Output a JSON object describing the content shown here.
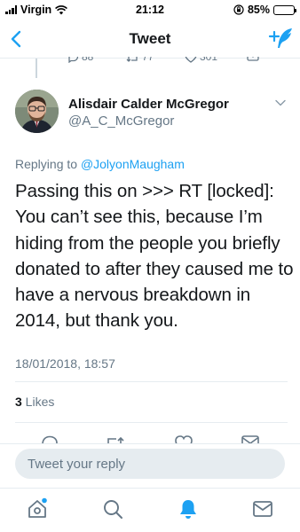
{
  "status_bar": {
    "carrier": "Virgin",
    "time": "21:12",
    "battery_percent": "85%",
    "battery_level": 0.85
  },
  "nav": {
    "title": "Tweet"
  },
  "previous_tweet_actions": {
    "replies": "88",
    "retweets": "77",
    "likes": "301"
  },
  "tweet": {
    "author_name": "Alisdair Calder McGregor",
    "author_handle": "@A_C_McGregor",
    "replying_to_prefix": "Replying to ",
    "replying_to_handle": "@JolyonMaugham",
    "text": "Passing this on >>> RT [locked]: You can’t see this, because I’m hiding from the people you briefly donated to after they caused me to have a nervous breakdown in 2014, but thank you.",
    "timestamp": "18/01/2018, 18:57",
    "likes_count": "3",
    "likes_label": " Likes"
  },
  "reply": {
    "placeholder": "Tweet your reply"
  },
  "colors": {
    "accent": "#1da1f2",
    "secondary_text": "#657786",
    "divider": "#e6ecf0"
  },
  "tabs": [
    {
      "name": "home",
      "icon": "home-icon",
      "has_notification_dot": true
    },
    {
      "name": "search",
      "icon": "search-icon",
      "has_notification_dot": false
    },
    {
      "name": "notifications",
      "icon": "bell-icon",
      "active": true
    },
    {
      "name": "messages",
      "icon": "envelope-icon",
      "has_notification_dot": false
    }
  ]
}
